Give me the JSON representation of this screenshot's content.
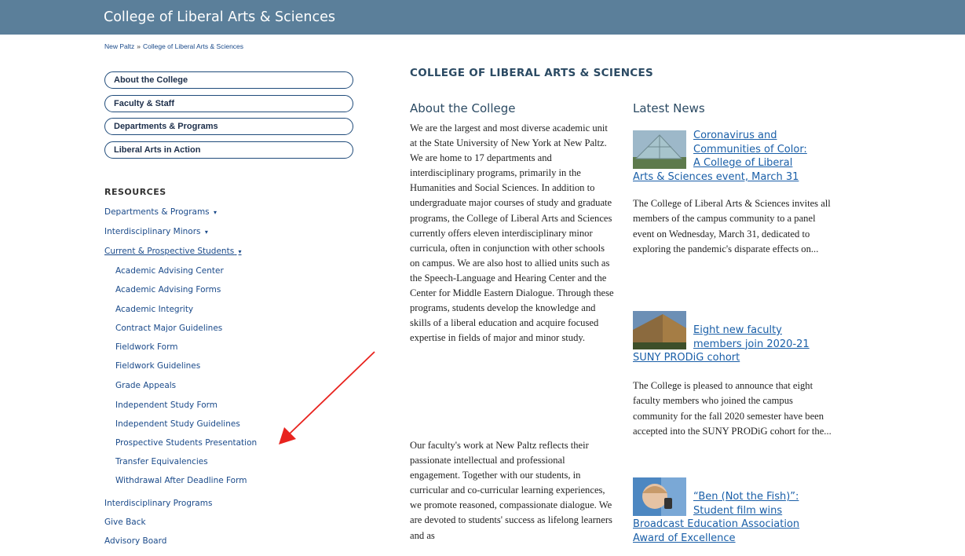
{
  "header": {
    "site_title": "College of Liberal Arts & Sciences"
  },
  "breadcrumb": {
    "items": [
      "New Paltz",
      "College of Liberal Arts & Sciences"
    ],
    "separator": "»"
  },
  "sidebar": {
    "pills": [
      "About the College",
      "Faculty & Staff",
      "Departments & Programs",
      "Liberal Arts in Action"
    ],
    "resources_heading": "RESOURCES",
    "resources": [
      {
        "label": "Departments & Programs",
        "caret": "▾"
      },
      {
        "label": "Interdisciplinary Minors",
        "caret": "▾"
      },
      {
        "label": "Current & Prospective Students",
        "caret": "▾"
      }
    ],
    "sub_items": [
      "Academic Advising Center",
      "Academic Advising Forms",
      "Academic Integrity",
      "Contract Major Guidelines",
      "Fieldwork Form",
      "Fieldwork Guidelines",
      "Grade Appeals",
      "Independent Study Form",
      "Independent Study Guidelines",
      "Prospective Students Presentation",
      "Transfer Equivalencies",
      "Withdrawal After Deadline Form"
    ],
    "bottom_links": [
      "Interdisciplinary Programs",
      "Give Back",
      "Advisory Board"
    ]
  },
  "main": {
    "page_heading": "COLLEGE OF LIBERAL ARTS & SCIENCES",
    "about": {
      "heading": "About the College",
      "p1": "We are the largest and most diverse academic unit at the State University of New York at New Paltz. We are home to 17 departments and interdisciplinary programs, primarily in the Humanities and Social Sciences. In addition to undergraduate major courses of study and graduate programs, the College of Liberal Arts and Sciences currently offers eleven interdisciplinary minor curricula, often in conjunction with other schools on campus. We are also host to allied units such as the Speech-Language and Hearing Center and the Center for Middle Eastern Dialogue. Through these programs, students develop the knowledge and skills of a liberal education and acquire focused expertise in fields of major and minor study.",
      "p2": "Our faculty's work at New Paltz reflects their passionate intellectual and professional engagement. Together with our students, in curricular and co-curricular learning experiences, we promote reasoned, compassionate dialogue. We are devoted to students' success as lifelong learners and as"
    },
    "news": {
      "heading": "Latest News",
      "items": [
        {
          "title_lines": [
            "Coronavirus and",
            "Communities of Color:",
            "A College of Liberal",
            "Arts & Sciences event, March 31"
          ],
          "summary": "The College of Liberal Arts & Sciences invites all members of the campus community to a panel event on Wednesday, March 31, dedicated to exploring the pandemic's disparate effects on..."
        },
        {
          "title_lines": [
            "Eight new faculty",
            "members join 2020-21",
            "SUNY PRODiG cohort"
          ],
          "summary": "The College is pleased to announce that eight faculty members who joined the campus community for the fall 2020 semester have been accepted into the SUNY PRODiG cohort for the..."
        },
        {
          "title_lines": [
            "“Ben (Not the Fish)”:",
            "Student film wins",
            "Broadcast Education Association",
            "Award of Excellence"
          ],
          "summary": ""
        }
      ]
    }
  },
  "colors": {
    "header_bg": "#5b7f9a",
    "link": "#1a4a8a",
    "news_link": "#1a5fa8",
    "heading": "#2b4a63",
    "pill_border": "#1f4b7a",
    "annotation_arrow": "#e8231e"
  }
}
